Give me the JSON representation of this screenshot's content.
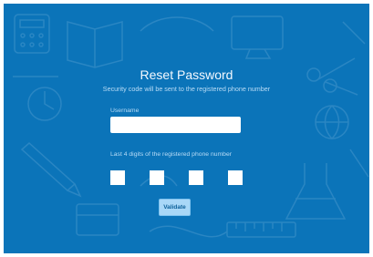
{
  "page": {
    "title": "Reset Password",
    "subtitle": "Security code will be sent to the registered phone number"
  },
  "form": {
    "username_label": "Username",
    "username_value": "",
    "digits_label": "Last 4 digits of the registered phone number",
    "digits": [
      "",
      "",
      "",
      ""
    ],
    "validate_label": "Validate"
  },
  "colors": {
    "background": "#0b74b9",
    "button": "#a8d7f7",
    "label_text": "#b9dcf6"
  },
  "icons": [
    "calculator-icon",
    "book-icon",
    "pencil-icon",
    "clock-icon",
    "monitor-icon",
    "scissors-icon",
    "flask-icon",
    "globe-icon"
  ]
}
